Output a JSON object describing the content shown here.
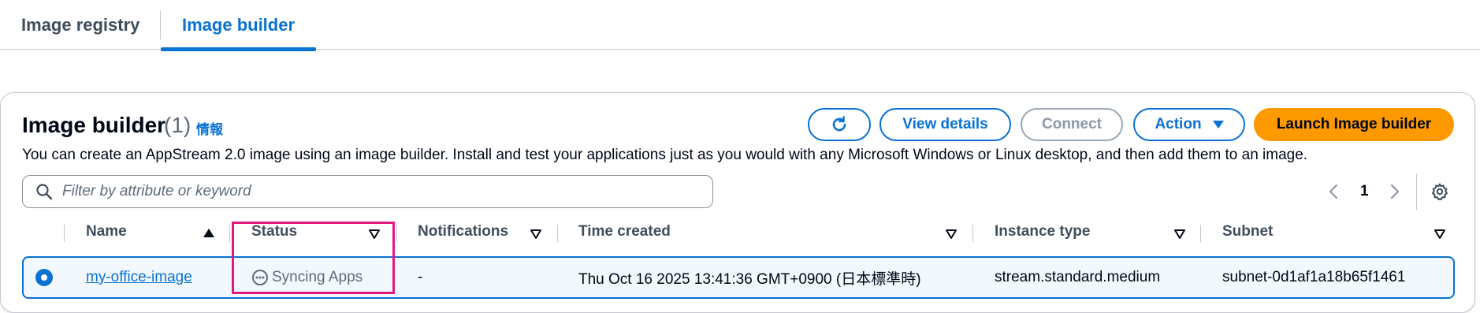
{
  "tabs": [
    {
      "label": "Image registry"
    },
    {
      "label": "Image builder"
    }
  ],
  "header": {
    "title": "Image builder",
    "count": "(1)",
    "info": "情報",
    "description": "You can create an AppStream 2.0 image using an image builder. Install and test your applications just as you would with any Microsoft Windows or Linux desktop, and then add them to an image."
  },
  "actions": {
    "view_details": "View details",
    "connect": "Connect",
    "action": "Action",
    "launch": "Launch Image builder"
  },
  "filter": {
    "placeholder": "Filter by attribute or keyword"
  },
  "pagination": {
    "current_page": "1"
  },
  "table": {
    "columns": [
      "Name",
      "Status",
      "Notifications",
      "Time created",
      "Instance type",
      "Subnet"
    ],
    "rows": [
      {
        "name": "my-office-image",
        "status": "Syncing Apps",
        "notifications": "-",
        "time_created": "Thu Oct 16 2025 13:41:36 GMT+0900 (日本標準時)",
        "instance_type": "stream.standard.medium",
        "subnet": "subnet-0d1af1a18b65f1461"
      }
    ]
  },
  "colors": {
    "primary": "#0972d3",
    "launch": "#ff9900",
    "highlight": "#e0197d"
  }
}
